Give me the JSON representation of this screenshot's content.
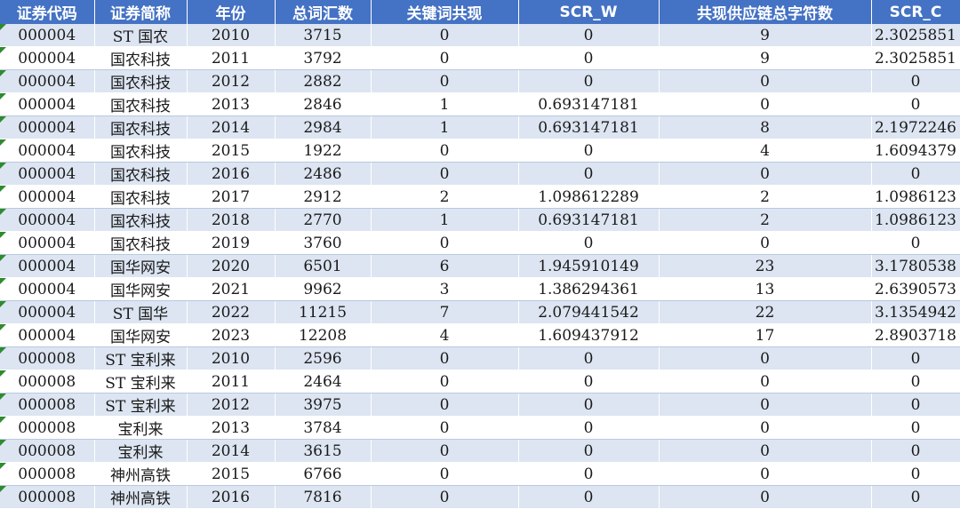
{
  "columns": [
    "证券代码",
    "证券简称",
    "年份",
    "总词汇数",
    "关键词共现",
    "SCR_W",
    "共现供应链总字符数",
    "SCR_C"
  ],
  "rows": [
    [
      "000004",
      "ST 国农",
      "2010",
      "3715",
      "0",
      "0",
      "9",
      "2.3025851"
    ],
    [
      "000004",
      "国农科技",
      "2011",
      "3792",
      "0",
      "0",
      "9",
      "2.3025851"
    ],
    [
      "000004",
      "国农科技",
      "2012",
      "2882",
      "0",
      "0",
      "0",
      "0"
    ],
    [
      "000004",
      "国农科技",
      "2013",
      "2846",
      "1",
      "0.693147181",
      "0",
      "0"
    ],
    [
      "000004",
      "国农科技",
      "2014",
      "2984",
      "1",
      "0.693147181",
      "8",
      "2.1972246"
    ],
    [
      "000004",
      "国农科技",
      "2015",
      "1922",
      "0",
      "0",
      "4",
      "1.6094379"
    ],
    [
      "000004",
      "国农科技",
      "2016",
      "2486",
      "0",
      "0",
      "0",
      "0"
    ],
    [
      "000004",
      "国农科技",
      "2017",
      "2912",
      "2",
      "1.098612289",
      "2",
      "1.0986123"
    ],
    [
      "000004",
      "国农科技",
      "2018",
      "2770",
      "1",
      "0.693147181",
      "2",
      "1.0986123"
    ],
    [
      "000004",
      "国农科技",
      "2019",
      "3760",
      "0",
      "0",
      "0",
      "0"
    ],
    [
      "000004",
      "国华网安",
      "2020",
      "6501",
      "6",
      "1.945910149",
      "23",
      "3.1780538"
    ],
    [
      "000004",
      "国华网安",
      "2021",
      "9962",
      "3",
      "1.386294361",
      "13",
      "2.6390573"
    ],
    [
      "000004",
      "ST 国华",
      "2022",
      "11215",
      "7",
      "2.079441542",
      "22",
      "3.1354942"
    ],
    [
      "000004",
      "国华网安",
      "2023",
      "12208",
      "4",
      "1.609437912",
      "17",
      "2.8903718"
    ],
    [
      "000008",
      "ST 宝利来",
      "2010",
      "2596",
      "0",
      "0",
      "0",
      "0"
    ],
    [
      "000008",
      "ST 宝利来",
      "2011",
      "2464",
      "0",
      "0",
      "0",
      "0"
    ],
    [
      "000008",
      "ST 宝利来",
      "2012",
      "3975",
      "0",
      "0",
      "0",
      "0"
    ],
    [
      "000008",
      "宝利来",
      "2013",
      "3784",
      "0",
      "0",
      "0",
      "0"
    ],
    [
      "000008",
      "宝利来",
      "2014",
      "3615",
      "0",
      "0",
      "0",
      "0"
    ],
    [
      "000008",
      "神州高铁",
      "2015",
      "6766",
      "0",
      "0",
      "0",
      "0"
    ],
    [
      "000008",
      "神州高铁",
      "2016",
      "7816",
      "0",
      "0",
      "0",
      "0"
    ]
  ],
  "colors": {
    "header_bg": "#4472c4",
    "header_text": "#ffffff",
    "band_row": "#dce5f1",
    "plain_row": "#ffffff",
    "cell_marker": "#2e8b2e"
  }
}
